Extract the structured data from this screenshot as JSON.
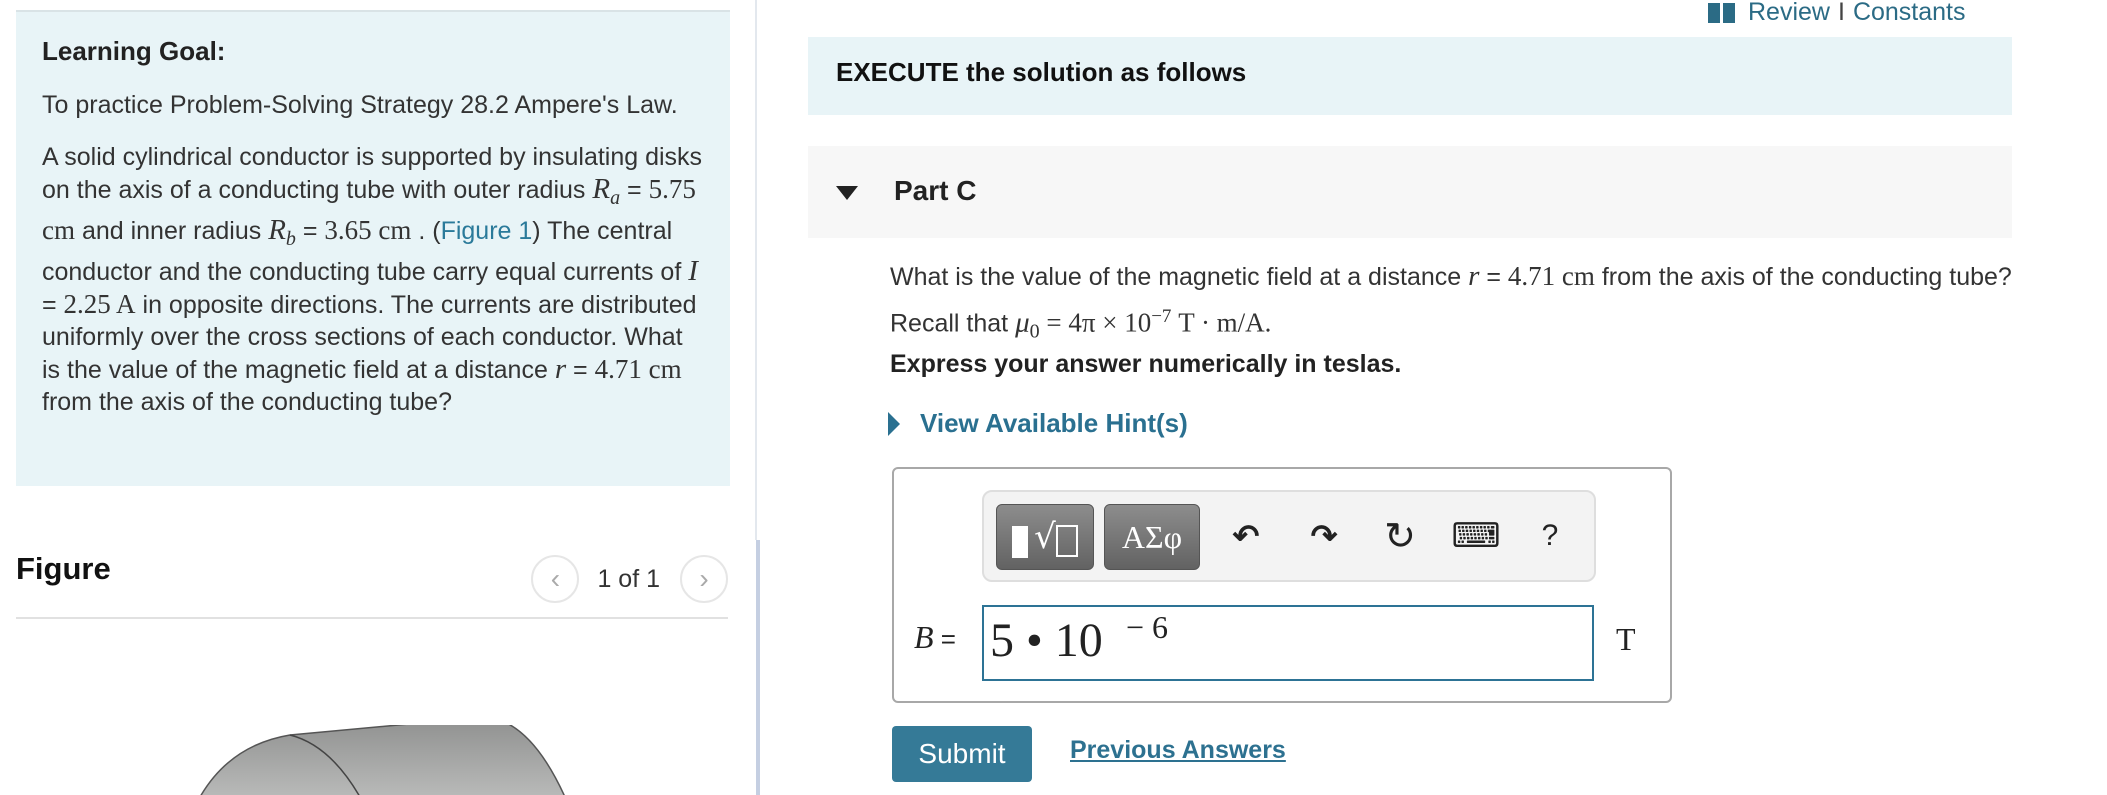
{
  "header": {
    "review_label": "Review",
    "separator": "I",
    "constants_label": "Constants",
    "book_icon": "book-icon"
  },
  "learning_goal": {
    "heading": "Learning Goal:",
    "intro": "To practice Problem-Solving Strategy 28.2 Ampere's Law.",
    "problem": {
      "t1": "A solid cylindrical conductor is supported by insulating disks on the axis of a conducting tube with outer radius ",
      "Ra_symbol": "R",
      "Ra_sub": "a",
      "Ra_eq": " = ",
      "Ra_value": "5.75 cm",
      "t2": " and inner radius ",
      "Rb_symbol": "R",
      "Rb_sub": "b",
      "Rb_eq": " = ",
      "Rb_value": "3.65 cm",
      "t3": " . (",
      "figure_link": "Figure 1",
      "t4": ") The central conductor and the conducting tube carry equal currents of ",
      "I_symbol": "I",
      "I_eq": " = ",
      "I_value": "2.25 A",
      "t5": " in opposite directions. The currents are distributed uniformly over the cross sections of each conductor. What is the value of the magnetic field at a distance ",
      "r_symbol": "r",
      "r_eq": " = ",
      "r_value": "4.71 cm",
      "t6": " from the axis of the conducting tube?"
    }
  },
  "figure": {
    "title": "Figure",
    "page_indicator": "1 of 1",
    "prev_icon": "chevron-left-icon",
    "next_icon": "chevron-right-icon",
    "prev_glyph": "‹",
    "next_glyph": "›"
  },
  "main": {
    "section_banner": "EXECUTE the solution as follows",
    "part_label": "Part C",
    "question": {
      "q1": "What is the value of the magnetic field at a distance ",
      "r_symbol": "r",
      "r_eq": " = ",
      "r_value": "4.71 cm",
      "q2": " from the axis of the conducting tube? Recall that ",
      "mu_symbol": "μ",
      "mu_sub": "0",
      "mu_eq": " = 4π × 10",
      "mu_exp": "−7",
      "mu_units": " T · m/A."
    },
    "instruction": "Express your answer numerically in teslas.",
    "hints_label": "View Available Hint(s)",
    "toolbar": {
      "templates_glyph": "√",
      "greek_label": "ΑΣφ",
      "undo_glyph": "↶",
      "redo_glyph": "↷",
      "reset_glyph": "↻",
      "keyboard_glyph": "⌨",
      "help_glyph": "?"
    },
    "answer": {
      "variable": "B",
      "equals": " =",
      "value": "5 • 10",
      "exponent": "− 6",
      "unit": "T"
    },
    "submit_label": "Submit",
    "previous_answers_label": "Previous Answers"
  }
}
